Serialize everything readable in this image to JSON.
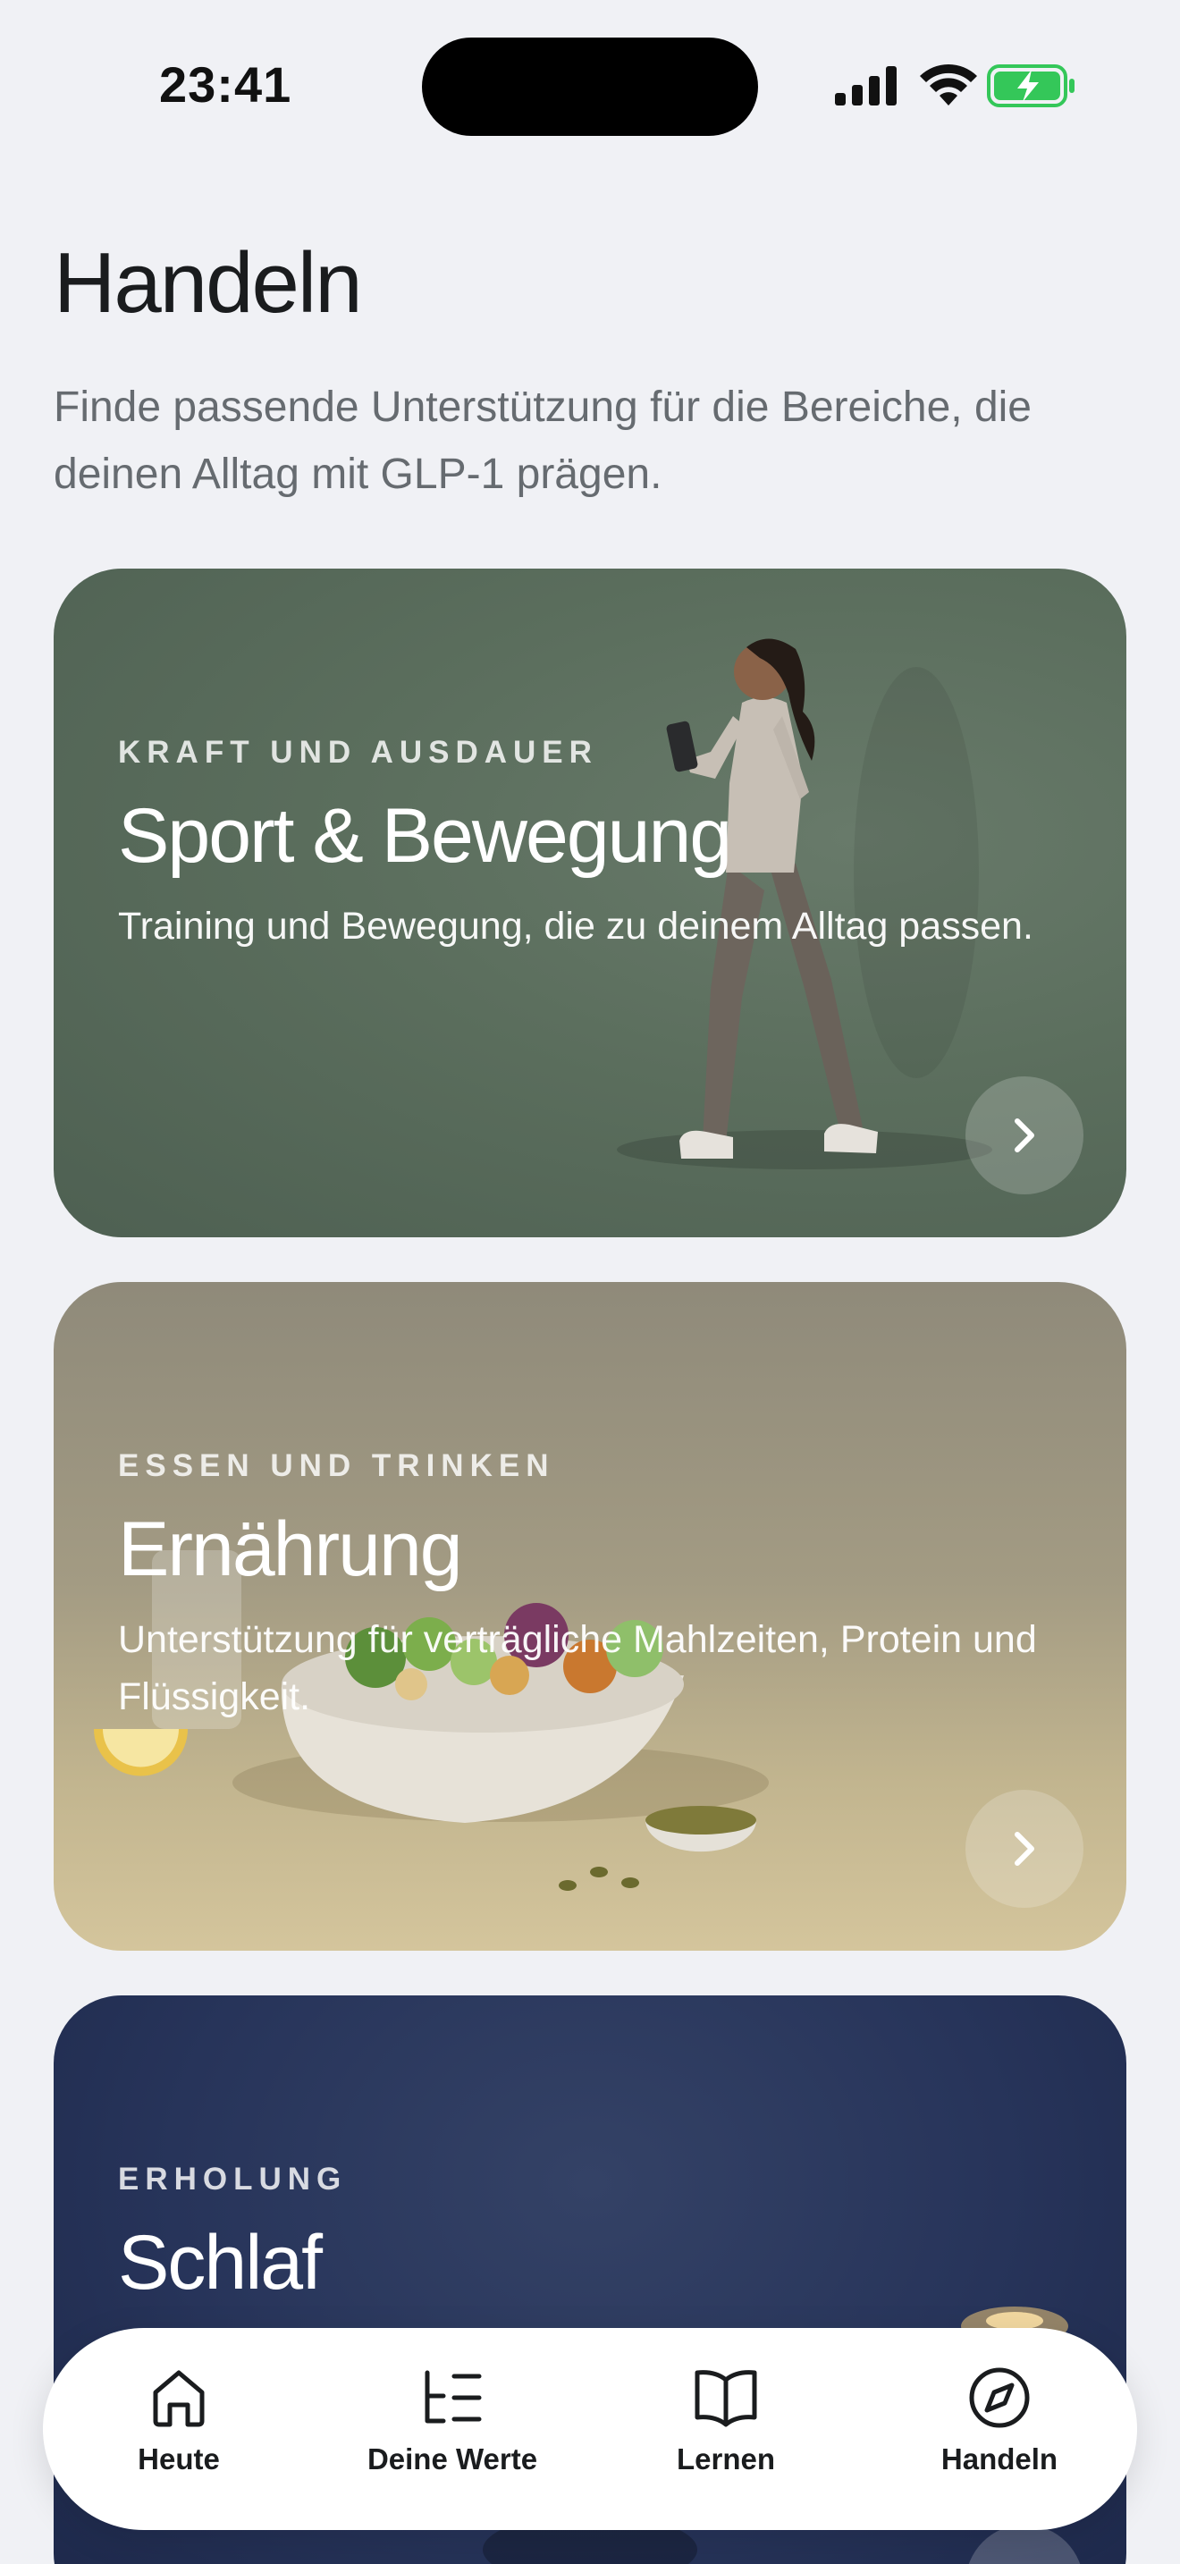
{
  "status_bar": {
    "time": "23:41",
    "icons": [
      "signal-icon",
      "wifi-icon",
      "battery-charging-icon"
    ]
  },
  "header": {
    "title": "Handeln",
    "subtitle": "Finde passende Unterstützung für die Bereiche, die deinen Alltag mit GLP-1 prägen."
  },
  "cards": [
    {
      "eyebrow": "KRAFT UND AUSDAUER",
      "title": "Sport & Bewegung",
      "description": "Training und Bewegung, die zu deinem Alltag passen.",
      "icon": "chevron-right-icon"
    },
    {
      "eyebrow": "ESSEN UND TRINKEN",
      "title": "Ernährung",
      "description": "Unterstützung für verträgliche Mahlzeiten, Protein und Flüssigkeit.",
      "icon": "chevron-right-icon"
    },
    {
      "eyebrow": "ERHOLUNG",
      "title": "Schlaf",
      "icon": "chevron-right-icon"
    }
  ],
  "tab_bar": {
    "items": [
      {
        "label": "Heute",
        "icon": "home-icon"
      },
      {
        "label": "Deine Werte",
        "icon": "list-icon"
      },
      {
        "label": "Lernen",
        "icon": "book-icon"
      },
      {
        "label": "Handeln",
        "icon": "compass-icon"
      }
    ]
  },
  "colors": {
    "background": "#f0f1f5",
    "sport_card": "#5b6e5d",
    "food_card": "#a39b83",
    "sleep_card": "#27345a",
    "battery_green": "#34c759"
  }
}
